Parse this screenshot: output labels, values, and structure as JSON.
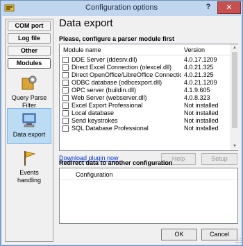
{
  "window": {
    "title": "Configuration options",
    "help_label": "?",
    "close_label": "✕"
  },
  "sidebar": {
    "tabs": [
      {
        "label": "COM port",
        "active": false
      },
      {
        "label": "Log file",
        "active": false
      },
      {
        "label": "Other",
        "active": false
      },
      {
        "label": "Modules",
        "active": true
      }
    ],
    "items": [
      {
        "label": "Query Parse Filter",
        "icon": "gear-puzzle-icon",
        "selected": false
      },
      {
        "label": "Data export",
        "icon": "computer-export-icon",
        "selected": true
      },
      {
        "label": "Events handling",
        "icon": "flag-icon",
        "selected": false
      }
    ]
  },
  "main": {
    "heading": "Data export",
    "subheading": "Please, configure a parser module first",
    "columns": {
      "name": "Module name",
      "version": "Version"
    },
    "modules": [
      {
        "name": "DDE Server (ddesrv.dll)",
        "version": "4.0.17.1209"
      },
      {
        "name": "Direct Excel Connection (olexcel.dll)",
        "version": "4.0.21.325"
      },
      {
        "name": "Direct OpenOffice/LibreOffice Connection (...)",
        "version": "4.0.21.325"
      },
      {
        "name": "ODBC database (odbcexport.dll)",
        "version": "4.0.21.1209"
      },
      {
        "name": "OPC server (buildin.dll)",
        "version": "4.1.9.605"
      },
      {
        "name": "Web Server (webserver.dll)",
        "version": "4.0.8.323"
      },
      {
        "name": "Excel Export Professional",
        "version": "Not installed"
      },
      {
        "name": "Local database",
        "version": "Not installed"
      },
      {
        "name": "Send keystrokes",
        "version": "Not installed"
      },
      {
        "name": "SQL Database Professional",
        "version": "Not installed"
      }
    ],
    "download_link": "Download plugin now",
    "help_button": "Help",
    "setup_button": "Setup",
    "redirect_heading": "Redirect data to another configuration",
    "redirect_column": "Configuration"
  },
  "footer": {
    "ok_label": "OK",
    "cancel_label": "Cancel"
  }
}
